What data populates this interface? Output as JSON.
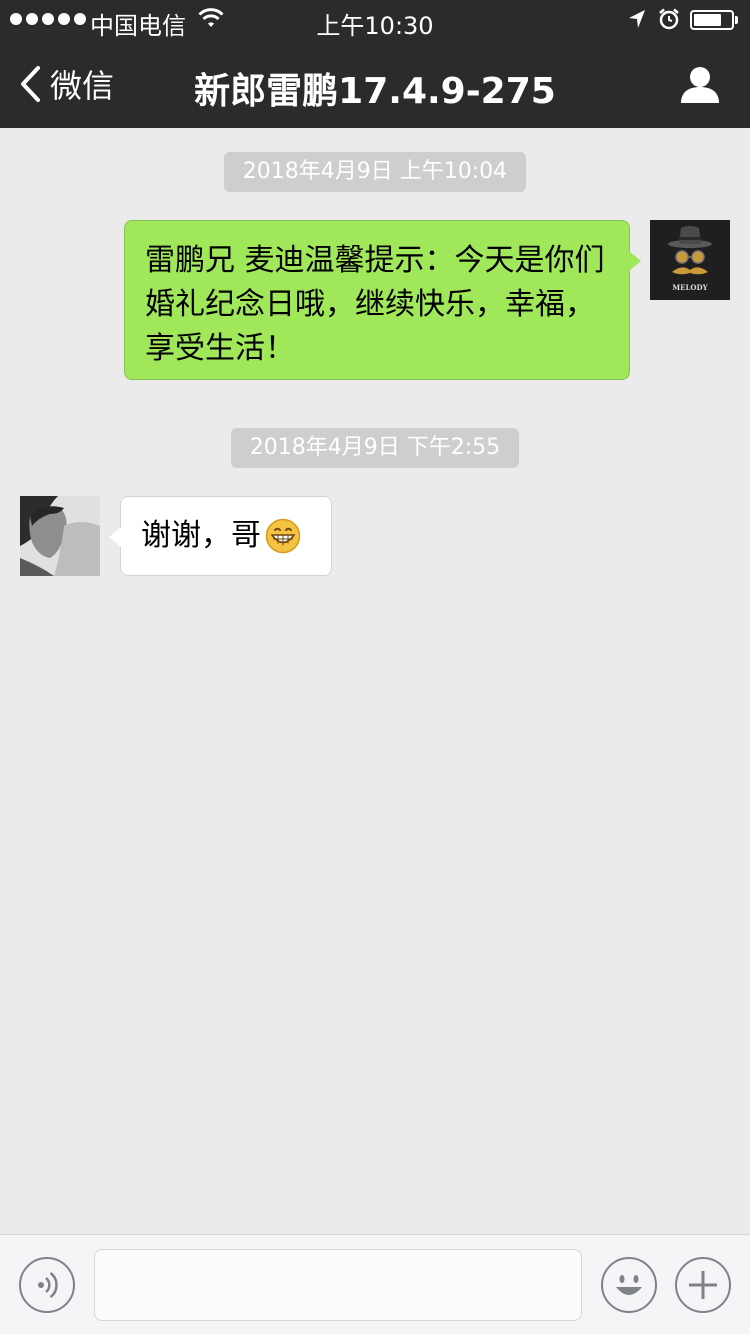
{
  "status_bar": {
    "carrier": "中国电信",
    "time": "上午10:30",
    "signal_icon": "signal-dots-icon",
    "wifi_icon": "wifi-icon",
    "location_icon": "location-arrow-icon",
    "alarm_icon": "alarm-clock-icon",
    "battery_icon": "battery-icon",
    "battery_level": 0.75
  },
  "nav": {
    "back_label": "微信",
    "title": "新郎雷鹏17.4.9-275",
    "back_icon": "chevron-left-icon",
    "profile_icon": "person-icon"
  },
  "colors": {
    "bar_background": "#2b2b2d",
    "chat_background": "#ebebeb",
    "sent_bubble": "#a0e75a",
    "received_bubble": "#ffffff",
    "timestamp_pill": "#cecece"
  },
  "messages": [
    {
      "timestamp": "2018年4月9日 上午10:04",
      "direction": "sent",
      "text": "雷鹏兄 麦迪温馨提示：今天是你们婚礼纪念日哦，继续快乐，幸福，享受生活！",
      "avatar_label": "MELODY"
    },
    {
      "timestamp": "2018年4月9日 下午2:55",
      "direction": "received",
      "text": "谢谢，哥",
      "emoji": "grinning-face-icon"
    }
  ],
  "toolbar": {
    "voice_icon": "voice-input-icon",
    "input_value": "",
    "emoji_icon": "smiley-icon",
    "plus_icon": "plus-icon"
  }
}
